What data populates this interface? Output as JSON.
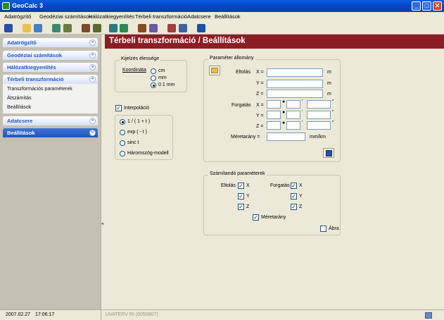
{
  "window": {
    "title": "GeoCalc 3"
  },
  "menu": [
    "Adatrögzítő",
    "Geodéziai számítások",
    "Hálózatkiegyenlítés",
    "Térbeli transzformáció",
    "Adatcsere",
    "Beállítások"
  ],
  "sidebar": {
    "adatrogzito": "Adatrögzítő",
    "geodeziai": "Geodéziai számítások",
    "halozat": "Hálózatkiegyenlítés",
    "terbeli": "Térbeli transzformáció",
    "terbeli_items": [
      "Transzformációs paraméterek",
      "Átszámítás",
      "Beállítások"
    ],
    "adatcsere": "Adatcsere",
    "beallitasok": "Beállítások"
  },
  "page": {
    "title": "Térbeli transzformáció / Beállítások"
  },
  "display": {
    "legend": "Kijelzés élessége",
    "coord_label": "Koordináta",
    "options": [
      "cm",
      "mm",
      "0.1 mm"
    ],
    "selected": "0.1 mm"
  },
  "interp": {
    "label": "Interpoláció",
    "checked": true,
    "options": [
      "1 / ( 1 + t )",
      "exp ( - t )",
      "sinc t",
      "Háromszög-modell"
    ],
    "selected": "1 / ( 1 + t )"
  },
  "params": {
    "legend": "Paraméter állomány",
    "eltolas_label": "Eltolás",
    "forgatas_label": "Forgatás",
    "axes": [
      "X =",
      "Y =",
      "Z ="
    ],
    "unit_m": "m",
    "meretarany_label": "Méretarány =",
    "meretarany_unit": "mm/km",
    "eltolas_values": [
      "",
      "",
      ""
    ],
    "forgatas_values": [
      [
        "",
        "",
        ""
      ],
      [
        "",
        "",
        ""
      ],
      [
        "",
        "",
        ""
      ]
    ],
    "meretarany_value": ""
  },
  "computed": {
    "legend": "Számítandó paraméterek",
    "eltolas_label": "Eltolás",
    "forgatas_label": "Forgatás",
    "axes": [
      "X",
      "Y",
      "Z"
    ],
    "meretarany": "Méretarány",
    "abra": "Ábra"
  },
  "status": {
    "date": "2007.02.27",
    "time": "17:06:17",
    "license": "UVATERV Rt (6050807)"
  },
  "colors": {
    "header": "#8B1E24",
    "sidebar_selected": "#2155C0",
    "titlebar": "#0A5EE0"
  }
}
